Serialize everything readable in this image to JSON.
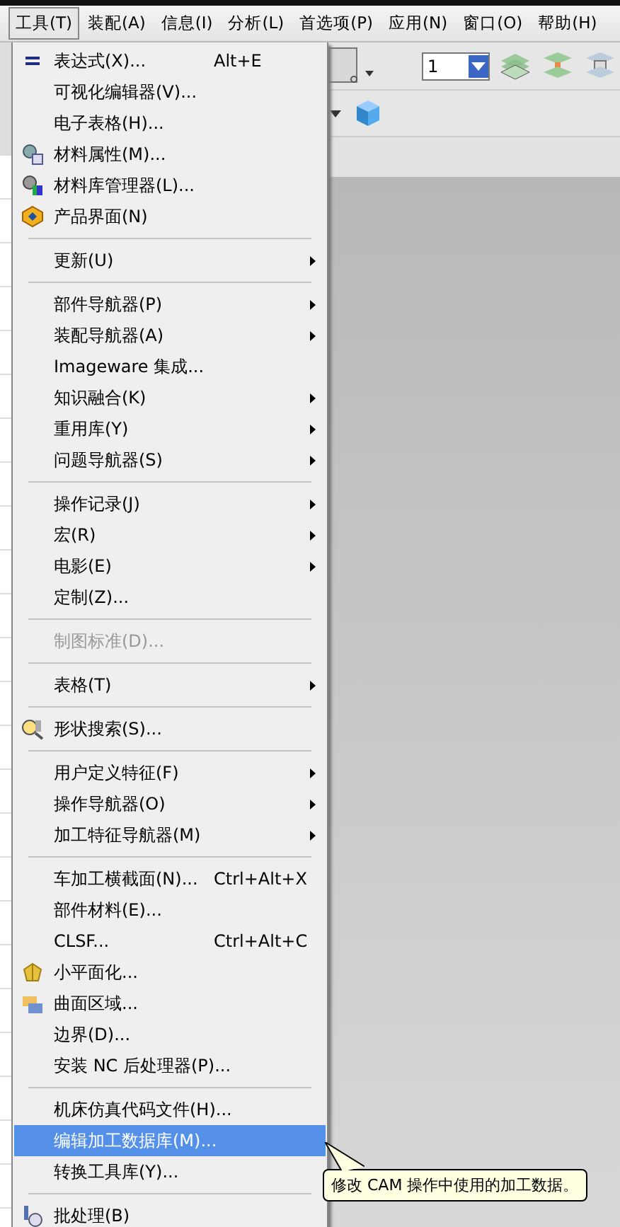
{
  "menubar": [
    {
      "label": "工具(T)",
      "selected": true
    },
    {
      "label": "装配(A)",
      "selected": false
    },
    {
      "label": "信息(I)",
      "selected": false
    },
    {
      "label": "分析(L)",
      "selected": false
    },
    {
      "label": "首选项(P)",
      "selected": false
    },
    {
      "label": "应用(N)",
      "selected": false
    },
    {
      "label": "窗口(O)",
      "selected": false
    },
    {
      "label": "帮助(H)",
      "selected": false
    }
  ],
  "toolbar": {
    "layer_field": {
      "value": "1"
    }
  },
  "menu": [
    {
      "kind": "icon_item",
      "label": "表达式(X)...",
      "shortcut": "Alt+E"
    },
    {
      "kind": "item",
      "label": "可视化编辑器(V)..."
    },
    {
      "kind": "item",
      "label": "电子表格(H)..."
    },
    {
      "kind": "icon_item",
      "label": "材料属性(M)..."
    },
    {
      "kind": "icon_item",
      "label": "材料库管理器(L)..."
    },
    {
      "kind": "icon_item",
      "label": "产品界面(N)"
    },
    {
      "kind": "separator"
    },
    {
      "kind": "item",
      "label": "更新(U)",
      "submenu": true
    },
    {
      "kind": "separator"
    },
    {
      "kind": "item",
      "label": "部件导航器(P)",
      "submenu": true
    },
    {
      "kind": "item",
      "label": "装配导航器(A)",
      "submenu": true
    },
    {
      "kind": "item",
      "label": "Imageware 集成..."
    },
    {
      "kind": "item",
      "label": "知识融合(K)",
      "submenu": true
    },
    {
      "kind": "item",
      "label": "重用库(Y)",
      "submenu": true
    },
    {
      "kind": "item",
      "label": "问题导航器(S)",
      "submenu": true
    },
    {
      "kind": "separator"
    },
    {
      "kind": "item",
      "label": "操作记录(J)",
      "submenu": true
    },
    {
      "kind": "item",
      "label": "宏(R)",
      "submenu": true
    },
    {
      "kind": "item",
      "label": "电影(E)",
      "submenu": true
    },
    {
      "kind": "item",
      "label": "定制(Z)..."
    },
    {
      "kind": "separator"
    },
    {
      "kind": "item",
      "label": "制图标准(D)...",
      "disabled": true
    },
    {
      "kind": "separator"
    },
    {
      "kind": "item",
      "label": "表格(T)",
      "submenu": true
    },
    {
      "kind": "separator"
    },
    {
      "kind": "icon_item",
      "label": "形状搜索(S)..."
    },
    {
      "kind": "separator"
    },
    {
      "kind": "item",
      "label": "用户定义特征(F)",
      "submenu": true
    },
    {
      "kind": "item",
      "label": "操作导航器(O)",
      "submenu": true
    },
    {
      "kind": "item",
      "label": "加工特征导航器(M)",
      "submenu": true
    },
    {
      "kind": "separator"
    },
    {
      "kind": "item",
      "label": "车加工横截面(N)...",
      "shortcut": "Ctrl+Alt+X"
    },
    {
      "kind": "item",
      "label": "部件材料(E)..."
    },
    {
      "kind": "item",
      "label": "CLSF...",
      "shortcut": "Ctrl+Alt+C"
    },
    {
      "kind": "icon_item",
      "label": "小平面化..."
    },
    {
      "kind": "icon_item",
      "label": "曲面区域..."
    },
    {
      "kind": "item",
      "label": "边界(D)..."
    },
    {
      "kind": "item",
      "label": "安装 NC 后处理器(P)..."
    },
    {
      "kind": "separator"
    },
    {
      "kind": "item",
      "label": "机床仿真代码文件(H)..."
    },
    {
      "kind": "item",
      "label": "编辑加工数据库(M)...",
      "selected": true
    },
    {
      "kind": "item",
      "label": "转换工具库(Y)..."
    },
    {
      "kind": "separator"
    },
    {
      "kind": "icon_item",
      "label": "批处理(B)"
    }
  ],
  "tooltip": {
    "text": "修改 CAM 操作中使用的加工数据。"
  }
}
